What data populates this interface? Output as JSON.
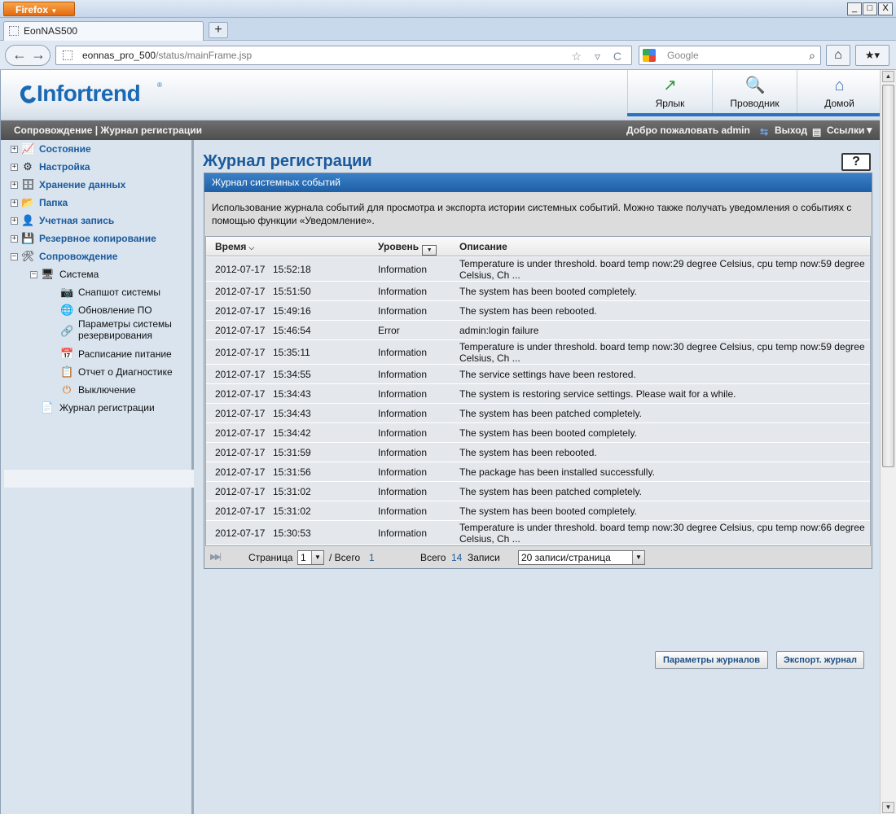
{
  "browser": {
    "menu_button": "Firefox",
    "menu_arrow": "▼",
    "window_buttons": [
      "_",
      "□",
      "X"
    ],
    "tab_title": "EonNAS500",
    "new_tab": "+",
    "back_forward": "← →",
    "url_host": "eonnas_pro_500",
    "url_path": "/status/mainFrame.jsp",
    "url_tools": "☆ ▿ C",
    "search_placeholder": "Google",
    "search_icon": "magnifier-icon",
    "home_icon": "⌂",
    "bookmarks_icon": "★▾"
  },
  "header": {
    "logo_text": "Infortrend",
    "logo_reg": "®",
    "buttons": [
      {
        "label": "Ярлык",
        "icon": "↗"
      },
      {
        "label": "Проводник",
        "icon": "🔍"
      },
      {
        "label": "Домой",
        "icon": "⌂"
      }
    ]
  },
  "crumbbar": {
    "breadcrumb": "Сопровождение | Журнал регистрации",
    "welcome": "Добро пожаловать admin",
    "logout": "Выход",
    "links": "Ссылки▼"
  },
  "sidebar": {
    "items": [
      {
        "label": "Состояние",
        "icon": "📈",
        "expander": "+"
      },
      {
        "label": "Настройка",
        "icon": "⚙",
        "expander": "+"
      },
      {
        "label": "Хранение данных",
        "icon": "🗄",
        "expander": "+"
      },
      {
        "label": "Папка",
        "icon": "📂",
        "expander": "+"
      },
      {
        "label": "Учетная запись",
        "icon": "👤",
        "expander": "+"
      },
      {
        "label": "Резервное копирование",
        "icon": "💾",
        "expander": "+"
      },
      {
        "label": "Сопровождение",
        "icon": "🛠",
        "expander": "−"
      }
    ],
    "system": {
      "label": "Система",
      "icon": "🖥",
      "expander": "−"
    },
    "system_children": [
      {
        "label": "Снапшот системы",
        "icon": "📷"
      },
      {
        "label": "Обновление ПО",
        "icon": "🌐"
      },
      {
        "label": "Параметры системы",
        "label2": "резервирования",
        "icon": "🔗"
      },
      {
        "label": "Расписание питание",
        "icon": "📅"
      },
      {
        "label": "Отчет о Диагностике",
        "icon": "📋"
      },
      {
        "label": "Выключение",
        "icon": "⏻"
      }
    ],
    "log": {
      "label": "Журнал регистрации",
      "icon": "📄"
    }
  },
  "main": {
    "title": "Журнал регистрации",
    "help": "?",
    "panel_title": "Журнал системных событий",
    "description": "Использование журнала событий для просмотра и экспорта истории системных событий. Можно также получать уведомления о событиях с помощью функции «Уведомление».",
    "columns": {
      "time": "Время",
      "time_sort": "⌵",
      "level": "Уровень",
      "level_filter": "▼",
      "desc": "Описание"
    },
    "rows": [
      {
        "date": "2012-07-17",
        "time": "15:52:18",
        "level": "Information",
        "desc": "Temperature is under threshold. board temp now:29 degree Celsius, cpu temp now:59 degree Celsius, Ch ..."
      },
      {
        "date": "2012-07-17",
        "time": "15:51:50",
        "level": "Information",
        "desc": "The system has been booted completely."
      },
      {
        "date": "2012-07-17",
        "time": "15:49:16",
        "level": "Information",
        "desc": "The system has been rebooted."
      },
      {
        "date": "2012-07-17",
        "time": "15:46:54",
        "level": "Error",
        "desc": "admin:login failure"
      },
      {
        "date": "2012-07-17",
        "time": "15:35:11",
        "level": "Information",
        "desc": "Temperature is under threshold. board temp now:30 degree Celsius, cpu temp now:59 degree Celsius, Ch ..."
      },
      {
        "date": "2012-07-17",
        "time": "15:34:55",
        "level": "Information",
        "desc": "The service settings have been restored."
      },
      {
        "date": "2012-07-17",
        "time": "15:34:43",
        "level": "Information",
        "desc": "The system is restoring service settings. Please wait for a while."
      },
      {
        "date": "2012-07-17",
        "time": "15:34:43",
        "level": "Information",
        "desc": "The system has been patched completely."
      },
      {
        "date": "2012-07-17",
        "time": "15:34:42",
        "level": "Information",
        "desc": "The system has been booted completely."
      },
      {
        "date": "2012-07-17",
        "time": "15:31:59",
        "level": "Information",
        "desc": "The system has been rebooted."
      },
      {
        "date": "2012-07-17",
        "time": "15:31:56",
        "level": "Information",
        "desc": "The package has been installed successfully."
      },
      {
        "date": "2012-07-17",
        "time": "15:31:02",
        "level": "Information",
        "desc": "The system has been patched completely."
      },
      {
        "date": "2012-07-17",
        "time": "15:31:02",
        "level": "Information",
        "desc": "The system has been booted completely."
      },
      {
        "date": "2012-07-17",
        "time": "15:30:53",
        "level": "Information",
        "desc": "Temperature is under threshold. board temp now:30 degree Celsius, cpu temp now:66 degree Celsius, Ch ..."
      }
    ],
    "pager": {
      "first_last": "▶▶|",
      "page_label": "Страница",
      "page_value": "1",
      "of_label": "/ Всего",
      "total_pages": "1",
      "total_label": "Всего",
      "total_records": "14",
      "records_label": "Записи",
      "per_page": "20 записи/страница",
      "dd": "▼"
    },
    "buttons": {
      "log_settings": "Параметры журналов",
      "export": "Экспорт. журнал"
    }
  },
  "colors": {
    "brand": "#1a69b4",
    "panel_header": "#2a6db5",
    "row_bg": "#e4e8ec"
  }
}
